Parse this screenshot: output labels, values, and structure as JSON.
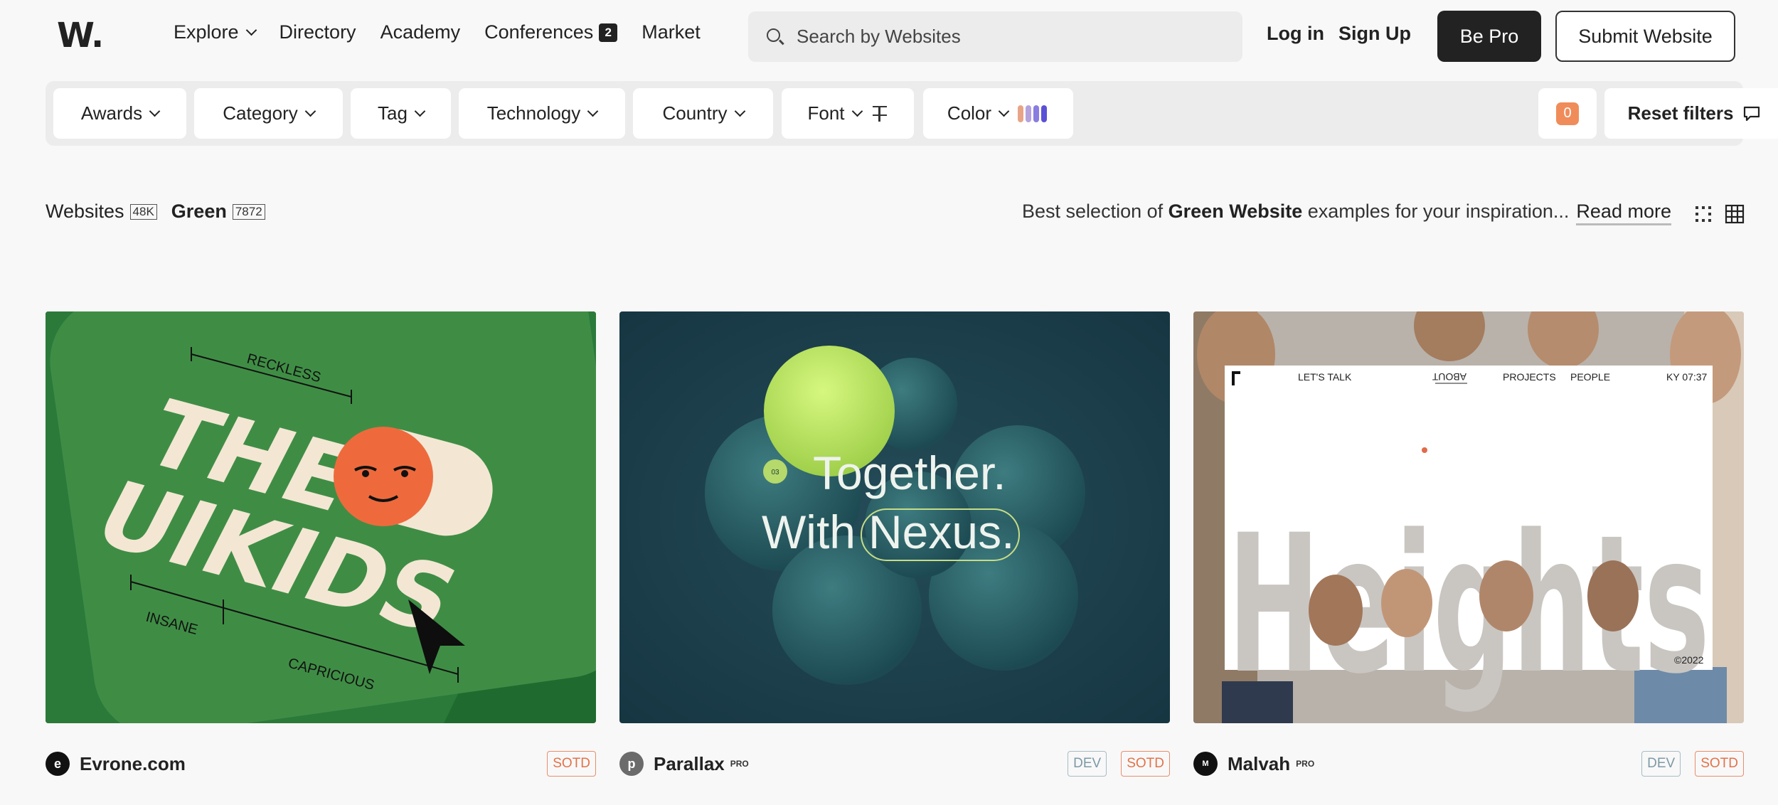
{
  "header": {
    "logo": "W.",
    "nav": [
      {
        "label": "Explore",
        "dropdown": true
      },
      {
        "label": "Directory"
      },
      {
        "label": "Academy"
      },
      {
        "label": "Conferences",
        "badge": "2"
      },
      {
        "label": "Market"
      }
    ],
    "search_placeholder": "Search by Websites",
    "login": "Log in",
    "signup": "Sign Up",
    "be_pro": "Be Pro",
    "submit": "Submit Website"
  },
  "filters": {
    "items": [
      "Awards",
      "Category",
      "Tag",
      "Technology",
      "Country",
      "Font",
      "Color"
    ],
    "color_swatches": [
      "#e8a487",
      "#b4a2dd",
      "#8a7de0",
      "#5b51d6"
    ],
    "count": "0",
    "reset": "Reset filters"
  },
  "subheader": {
    "websites": "Websites",
    "websites_count": "48K",
    "current": "Green",
    "current_count": "7872",
    "desc_prefix": "Best selection of",
    "desc_bold": "Green Website",
    "desc_suffix": "examples for your inspiration...",
    "read_more": "Read more"
  },
  "cards": [
    {
      "name": "Evrone.com",
      "avatar": "e",
      "pro": "",
      "badges": [
        "SOTD"
      ],
      "art": {
        "top": "RECKLESS",
        "line1": "THE",
        "line2": "UIKIDS",
        "left": "INSANE",
        "bottom": "CAPRICIOUS"
      }
    },
    {
      "name": "Parallax",
      "avatar": "p",
      "pro": "PRO",
      "badges": [
        "DEV",
        "SOTD"
      ],
      "art": {
        "num": "03",
        "line1": "Together.",
        "line2a": "With",
        "line2b": "Nexus."
      }
    },
    {
      "name": "Malvah",
      "avatar": "M",
      "pro": "PRO",
      "badges": [
        "DEV",
        "SOTD"
      ],
      "art": {
        "nav1": "LET'S TALK",
        "nav2": "ABOUT",
        "nav3": "PROJECTS",
        "nav4": "PEOPLE",
        "time": "KY 07:37",
        "big": "Heights",
        "copy": "©2022"
      }
    }
  ]
}
